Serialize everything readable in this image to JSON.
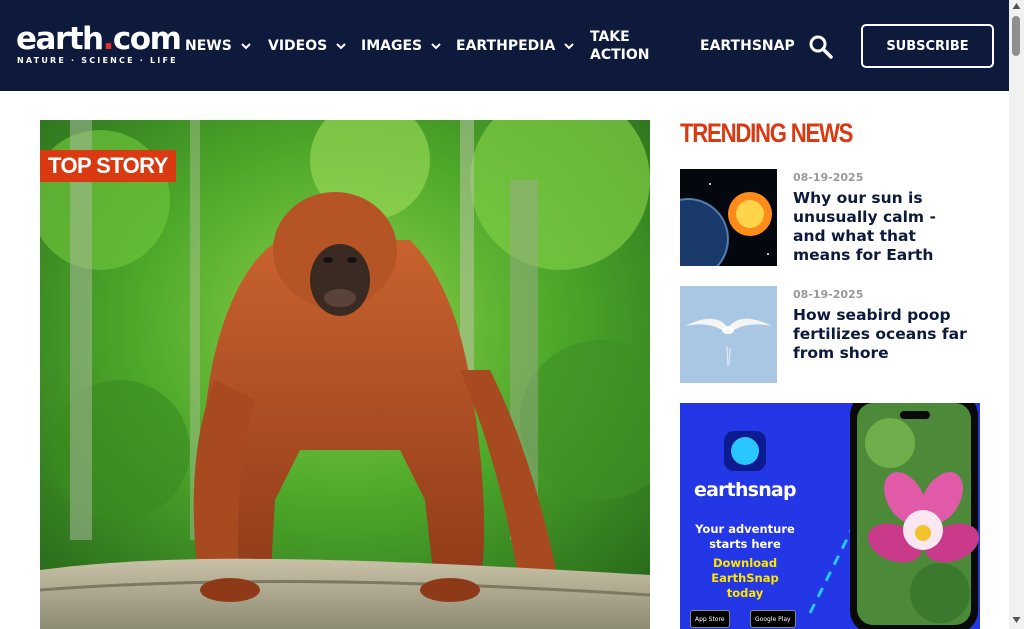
{
  "logo": {
    "word": "earth",
    "dot": ".",
    "tld": "com",
    "tagline": "NATURE · SCIENCE · LIFE"
  },
  "nav": {
    "news": "NEWS",
    "videos": "VIDEOS",
    "images": "IMAGES",
    "earthpedia": "EARTHPEDIA",
    "take_action_line1": "TAKE",
    "take_action_line2": "ACTION",
    "earthsnap": "EARTHSNAP",
    "subscribe": "SUBSCRIBE"
  },
  "hero": {
    "badge": "TOP STORY",
    "image": "orangutan-photo"
  },
  "trending": {
    "title": "TRENDING NEWS",
    "articles": [
      {
        "date": "08-19-2025",
        "headline": "Why our sun is unusually calm - and what that means for Earth",
        "image": "earth-and-sun"
      },
      {
        "date": "08-19-2025",
        "headline": "How seabird poop fertilizes oceans far from shore",
        "image": "seagull-in-sky"
      }
    ]
  },
  "ad": {
    "brand": "earthsnap",
    "tagline": "Your adventure starts here",
    "cta": "Download EarthSnap today",
    "app_store": "App Store",
    "google_play": "Google Play"
  },
  "colors": {
    "header_bg": "#0d1a3b",
    "accent": "#d93a12",
    "ad_bg": "#2337e6"
  }
}
